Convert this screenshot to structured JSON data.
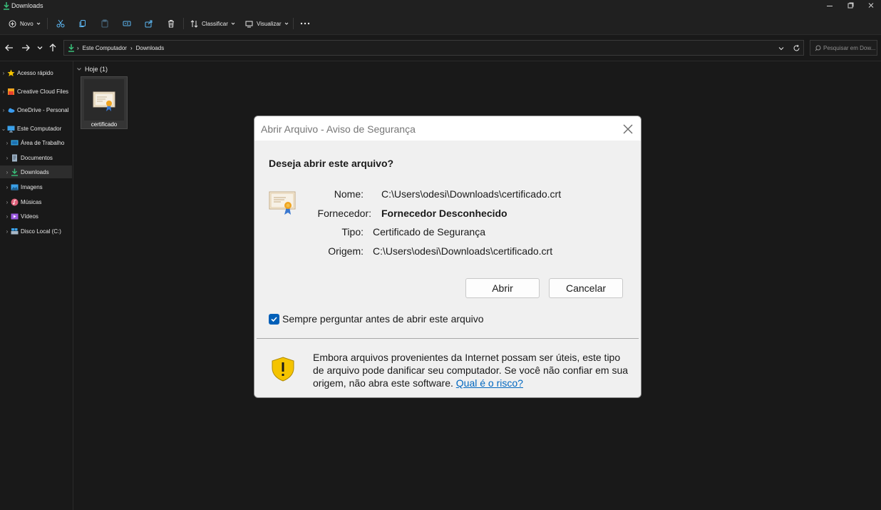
{
  "window": {
    "title": "Downloads"
  },
  "toolbar": {
    "new_label": "Novo",
    "sort_label": "Classificar",
    "view_label": "Visualizar",
    "more_label": "···"
  },
  "address": {
    "crumbs": [
      "Este Computador",
      "Downloads"
    ],
    "search_placeholder": "Pesquisar em Dow..."
  },
  "sidebar": {
    "items": [
      {
        "label": "Acesso rápido",
        "icon": "star-icon",
        "color": "#f5c400"
      },
      {
        "label": "Creative Cloud Files",
        "icon": "creative-cloud-folder-icon",
        "color": "#f0a420"
      },
      {
        "label": "OneDrive - Personal",
        "icon": "onedrive-icon",
        "color": "#3a9cf0"
      },
      {
        "label": "Este Computador",
        "icon": "computer-icon",
        "color": "#3aa0e8"
      },
      {
        "label": "Área de Trabalho",
        "icon": "desktop-icon",
        "color": "#3ab8f0"
      },
      {
        "label": "Documentos",
        "icon": "documents-icon",
        "color": "#9fb4c8"
      },
      {
        "label": "Downloads",
        "icon": "download-icon",
        "color": "#39c07a"
      },
      {
        "label": "Imagens",
        "icon": "pictures-icon",
        "color": "#3aa0e8"
      },
      {
        "label": "Músicas",
        "icon": "music-icon",
        "color": "#e0607a"
      },
      {
        "label": "Vídeos",
        "icon": "videos-icon",
        "color": "#9b5ae0"
      },
      {
        "label": "Disco Local (C:)",
        "icon": "drive-icon",
        "color": "#a8b8c8"
      }
    ]
  },
  "content": {
    "group_label": "Hoje (1)",
    "file_name": "certificado"
  },
  "dialog": {
    "title": "Abrir Arquivo - Aviso de Segurança",
    "question": "Deseja abrir este arquivo?",
    "name_label": "Nome:",
    "name_value": "C:\\Users\\odesi\\Downloads\\certificado.crt",
    "publisher_label": "Fornecedor:",
    "publisher_value": "Fornecedor Desconhecido",
    "type_label": "Tipo:",
    "type_value": "Certificado de Segurança",
    "origin_label": "Origem:",
    "origin_value": "C:\\Users\\odesi\\Downloads\\certificado.crt",
    "open_button": "Abrir",
    "cancel_button": "Cancelar",
    "checkbox_label": "Sempre perguntar antes de abrir este arquivo",
    "checkbox_checked": true,
    "warning_text": "Embora arquivos provenientes da Internet possam ser úteis, este tipo de arquivo pode danificar seu computador. Se você não confiar em sua origem, não abra este software.",
    "warning_link": "Qual é o risco?"
  }
}
